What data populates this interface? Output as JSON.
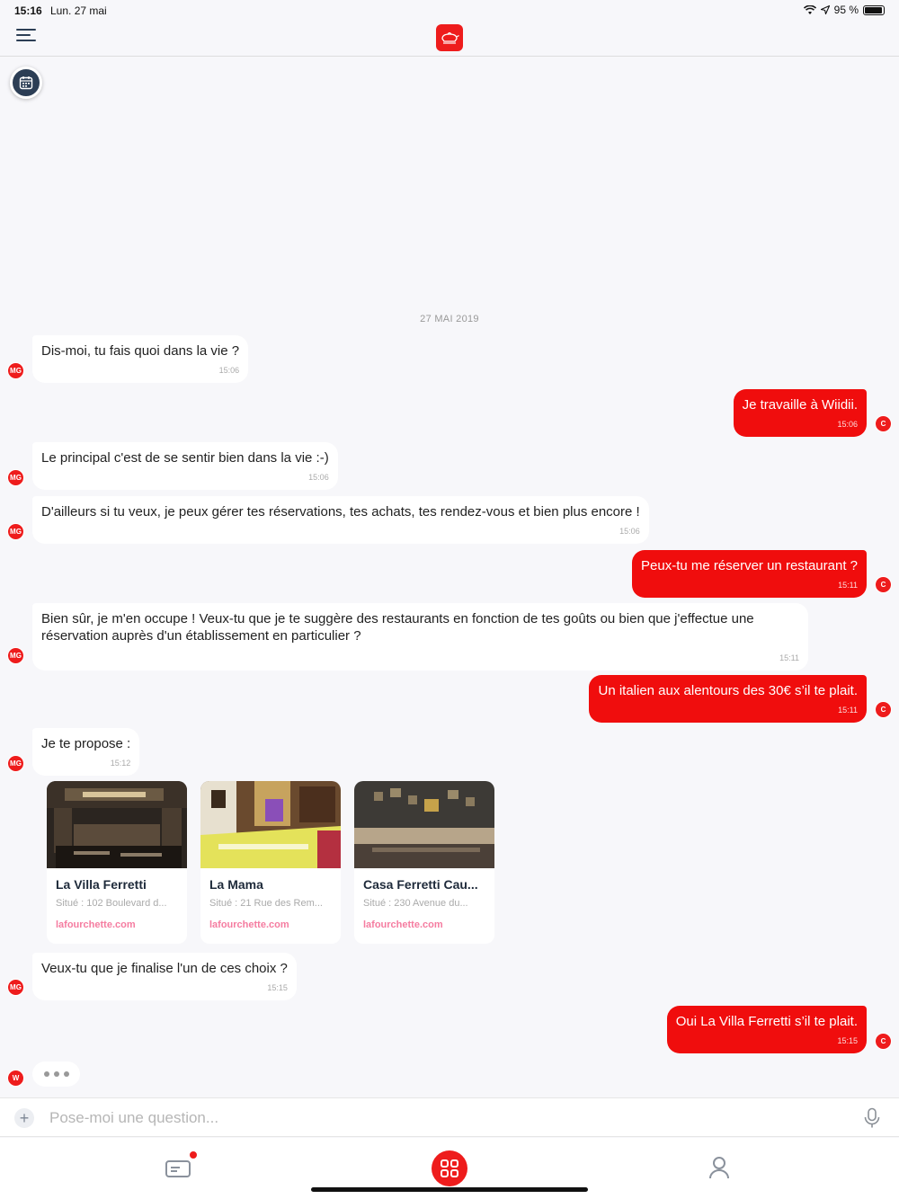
{
  "status": {
    "time": "15:16",
    "date": "Lun. 27 mai",
    "battery": "95 %",
    "battery_level": 0.95
  },
  "header": {
    "menu_icon": "hamburger-menu-icon",
    "logo": "wiidii-logo-icon"
  },
  "calendar_icon": "calendar-icon",
  "chat": {
    "date_separator": "27 MAI 2019",
    "messages": [
      {
        "from": "bot",
        "avatar": "MG",
        "text": "Dis-moi, tu fais quoi dans la vie ?",
        "time": "15:06"
      },
      {
        "from": "user",
        "avatar": "C",
        "text": "Je travaille à Wiidii.",
        "time": "15:06"
      },
      {
        "from": "bot",
        "avatar": "MG",
        "text": "Le principal c'est de se sentir bien dans la vie :-)",
        "time": "15:06"
      },
      {
        "from": "bot",
        "avatar": "MG",
        "text": "D'ailleurs si tu veux, je peux gérer tes réservations, tes achats, tes rendez-vous et bien plus encore !",
        "time": "15:06"
      },
      {
        "from": "user",
        "avatar": "C",
        "text": "Peux-tu me réserver un restaurant ?",
        "time": "15:11"
      },
      {
        "from": "bot",
        "avatar": "MG",
        "text": "Bien sûr, je m'en occupe ! Veux-tu que je te suggère des restaurants en fonction de tes goûts ou bien que j'effectue une réservation auprès d'un établissement en particulier ?",
        "time": "15:11"
      },
      {
        "from": "user",
        "avatar": "C",
        "text": "Un italien aux alentours des 30€ s’il te plait.",
        "time": "15:11"
      },
      {
        "from": "bot",
        "avatar": "MG",
        "text": "Je te propose :",
        "time": "15:12"
      },
      {
        "from": "bot",
        "avatar": "MG",
        "text": "Veux-tu que je finalise l'un de ces choix ?",
        "time": "15:15"
      },
      {
        "from": "user",
        "avatar": "C",
        "text": "Oui La Villa Ferretti s’il te plait.",
        "time": "15:15"
      }
    ],
    "typing_avatar": "W",
    "cards": [
      {
        "title": "La Villa Ferretti",
        "address": "Situé : 102 Boulevard d...",
        "link": "lafourchette.com"
      },
      {
        "title": "La Mama",
        "address": "Situé : 21 Rue des Rem...",
        "link": "lafourchette.com"
      },
      {
        "title": "Casa Ferretti Cau...",
        "address": "Situé : 230 Avenue du...",
        "link": "lafourchette.com"
      }
    ]
  },
  "input": {
    "placeholder": "Pose-moi une question...",
    "plus_icon": "plus-icon",
    "mic_icon": "microphone-icon"
  },
  "tabbar": {
    "left_icon": "ticket-icon",
    "center_icon": "grid-icon",
    "right_icon": "profile-icon"
  },
  "colors": {
    "accent": "#f00d0d",
    "navy": "#2c3e55",
    "link_pink": "#f57ca0",
    "background": "#f7f7fa"
  }
}
